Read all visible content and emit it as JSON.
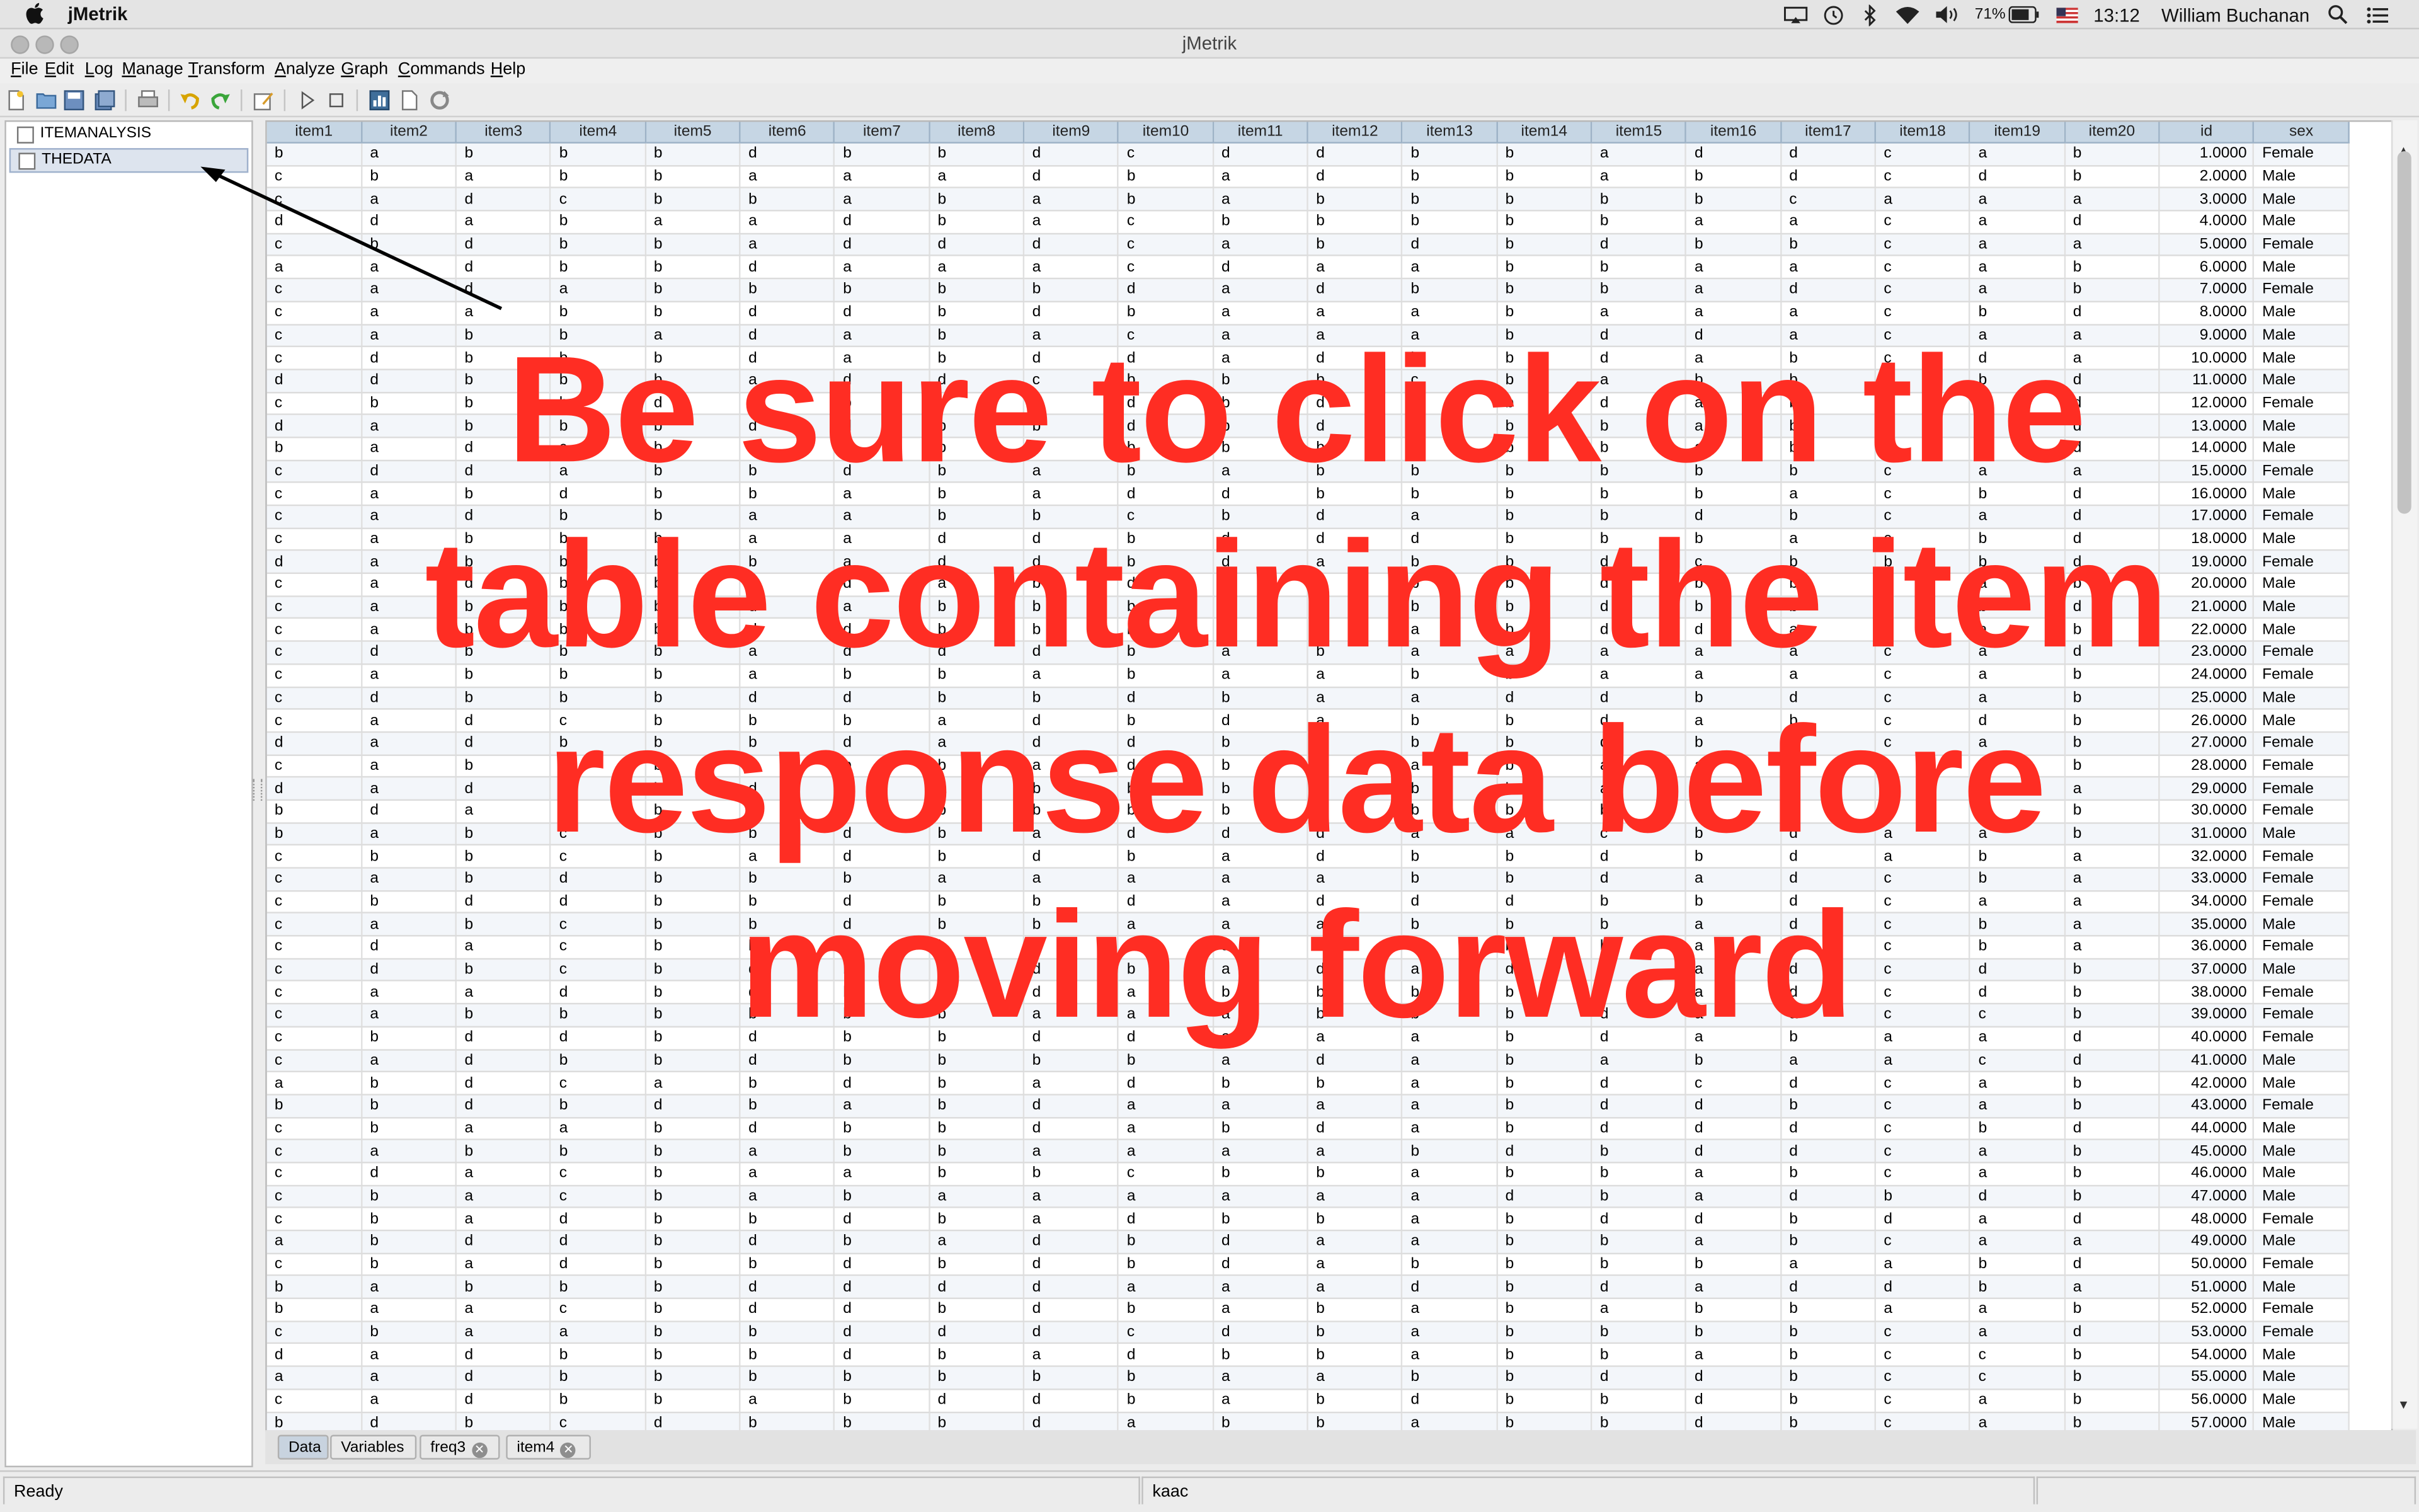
{
  "system_bar": {
    "app_name": "jMetrik",
    "battery_pct": "71%",
    "time": "13:12",
    "user": "William Buchanan"
  },
  "window": {
    "title": "jMetrik"
  },
  "menu": [
    {
      "label": "File",
      "u": "F",
      "rest": "ile"
    },
    {
      "label": "Edit",
      "u": "E",
      "rest": "dit"
    },
    {
      "label": "Log",
      "u": "L",
      "rest": "og"
    },
    {
      "label": "Manage",
      "u": "M",
      "rest": "anage"
    },
    {
      "label": "Transform",
      "u": "T",
      "rest": "ransform"
    },
    {
      "label": "Analyze",
      "u": "A",
      "rest": "nalyze"
    },
    {
      "label": "Graph",
      "u": "G",
      "rest": "raph"
    },
    {
      "label": "Commands",
      "u": "C",
      "rest": "ommands"
    },
    {
      "label": "Help",
      "u": "H",
      "rest": "elp"
    }
  ],
  "toolbar_icons": [
    "new-file-icon",
    "open-folder-icon",
    "save-icon",
    "save-all-icon",
    "print-icon",
    "undo-icon",
    "redo-icon",
    "edit-icon",
    "run-icon",
    "stop-icon",
    "chart-icon",
    "page-icon",
    "refresh-icon"
  ],
  "tree": {
    "items": [
      "ITEMANALYSIS",
      "THEDATA"
    ],
    "selected": 1
  },
  "table": {
    "columns": [
      "item1",
      "item2",
      "item3",
      "item4",
      "item5",
      "item6",
      "item7",
      "item8",
      "item9",
      "item10",
      "item11",
      "item12",
      "item13",
      "item14",
      "item15",
      "item16",
      "item17",
      "item18",
      "item19",
      "item20",
      "id",
      "sex"
    ],
    "rows": [
      "babbbdbbdcddbbaddcab|1.0000|Female",
      "cbabbaaadbadbbabdcdb|2.0000|Male",
      "cadcbbabababbbbbcaaa|3.0000|Male",
      "ddabaadbacbbbbbaacad|4.0000|Male",
      "cbdbbadddcabdbdbbcaa|5.0000|Female",
      "aadbbdaaacdaabbaacab|6.0000|Male",
      "cadabbbbbdadbbbadcab|7.0000|Female",
      "caabbddbdbaaabaaacbd|8.0000|Male",
      "cabbadabacaaabddacaa|9.0000|Male",
      "cdbbbdabddadbbdabcda|10.0000|Male",
      "ddbbbaddcbbbcbabbcbd|11.0000|Male",
      "cbbbdabbddbdbbdabcbd|12.0000|Female",
      "dabbbddbbdbdabbabcbd|13.0000|Male",
      "badcbbdbbbbbbbbababd|14.0000|Male",
      "cddabbdbababbbbbbcaa|15.0000|Female",
      "cabdbbabaddbbbbbacbd|16.0000|Male",
      "cadbbaabbcbdabbdbcad|17.0000|Female",
      "cabbbaaddbdddbbbacbd|18.0000|Male",
      "dabbbbaddbdabbdcbbbd|19.0000|Female",
      "cadbbddabdbabbdbbcab|20.0000|Male",
      "cabbbdabbbbdbbdbbcbd|21.0000|Male",
      "cabbbddbbbbdabddacab|22.0000|Male",
      "cdbbbadddbabaaaaacad|23.0000|Female",
      "cabbbabbabaabbaaacab|24.0000|Female",
      "cdbbbddbbdbaaddbdcab|25.0000|Male",
      "cadcbbbadbdabbdabcdb|26.0000|Male",
      "dadbbbdaddbabbdbacab|27.0000|Female",
      "cabbbdbbadbaabaaacab|28.0000|Female",
      "dadbbdbabbbbbbaabcaa|29.0000|Female",
      "bdacbdbbbbbbbbbbbcab|30.0000|Female",
      "babcbbdbadddaacbdaab|31.0000|Male",
      "cbbcbadbdbadbbdbdaba|32.0000|Female",
      "cabdbbbaaaaabbdadcba|33.0000|Female",
      "cbddbbdbbdadddbbdcaa|34.0000|Female",
      "cabcbbdbbaaabbbadcba|35.0000|Male",
      "cdacbbbbbbadbbbadcba|36.0000|Female",
      "cdbcbdbbdbadadbadcdb|37.0000|Male",
      "caadbdbadabbbbbadcdb|38.0000|Female",
      "cabbbbbbaaabbbdaaccb|39.0000|Female",
      "cbddbdbbddaaabdabaad|40.0000|Female",
      "cadbbdbbbbadababaacda|41.0000|Male",
      "abdcabdbadbbabdcdcab|42.0000|Male",
      "bbdbdbabdaaaabddbcab|43.0000|Female",
      "cbaabdbbdabdabdddcbd|44.0000|Male",
      "cabbbabbaaaabdbddcab|45.0000|Male",
      "cdacbaabbcbbabbabcab|46.0000|Male",
      "cbacbabaaaaaadbadbdb|47.0000|Male",
      "cbadbbdbadbbabddbdad|48.0000|Female",
      "abddbdbadbdaabbabcaa|49.0000|Male",
      "cbadbbdbdbdabbbbaabd|50.0000|Female",
      "babbbddddaaadbdaddba|51.0000|Male",
      "baacbddbdbabababbaab|52.0000|Female",
      "cbaabbdddcdbabbbbcad|53.0000|Female",
      "dadbbbdbadbbabbabccb|54.0000|Male",
      "aadbbbbbbbaabbddbccb|55.0000|Male",
      "cadbbabddbabdbbdbcab|56.0000|Male",
      "bdbcdbbbdabbabbdbcab|57.0000|Male"
    ]
  },
  "tabs": [
    {
      "label": "Data",
      "closable": false
    },
    {
      "label": "Variables",
      "closable": false
    },
    {
      "label": "freq3",
      "closable": true
    },
    {
      "label": "item4",
      "closable": true
    }
  ],
  "tab_close_glyph": "✕",
  "status": {
    "left": "Ready",
    "middle": "kaac",
    "right": ""
  },
  "overlay": {
    "lines": [
      "Be sure to click on the",
      "table containing the item",
      "response data before",
      "moving forward"
    ],
    "color": "#ff2d23"
  }
}
